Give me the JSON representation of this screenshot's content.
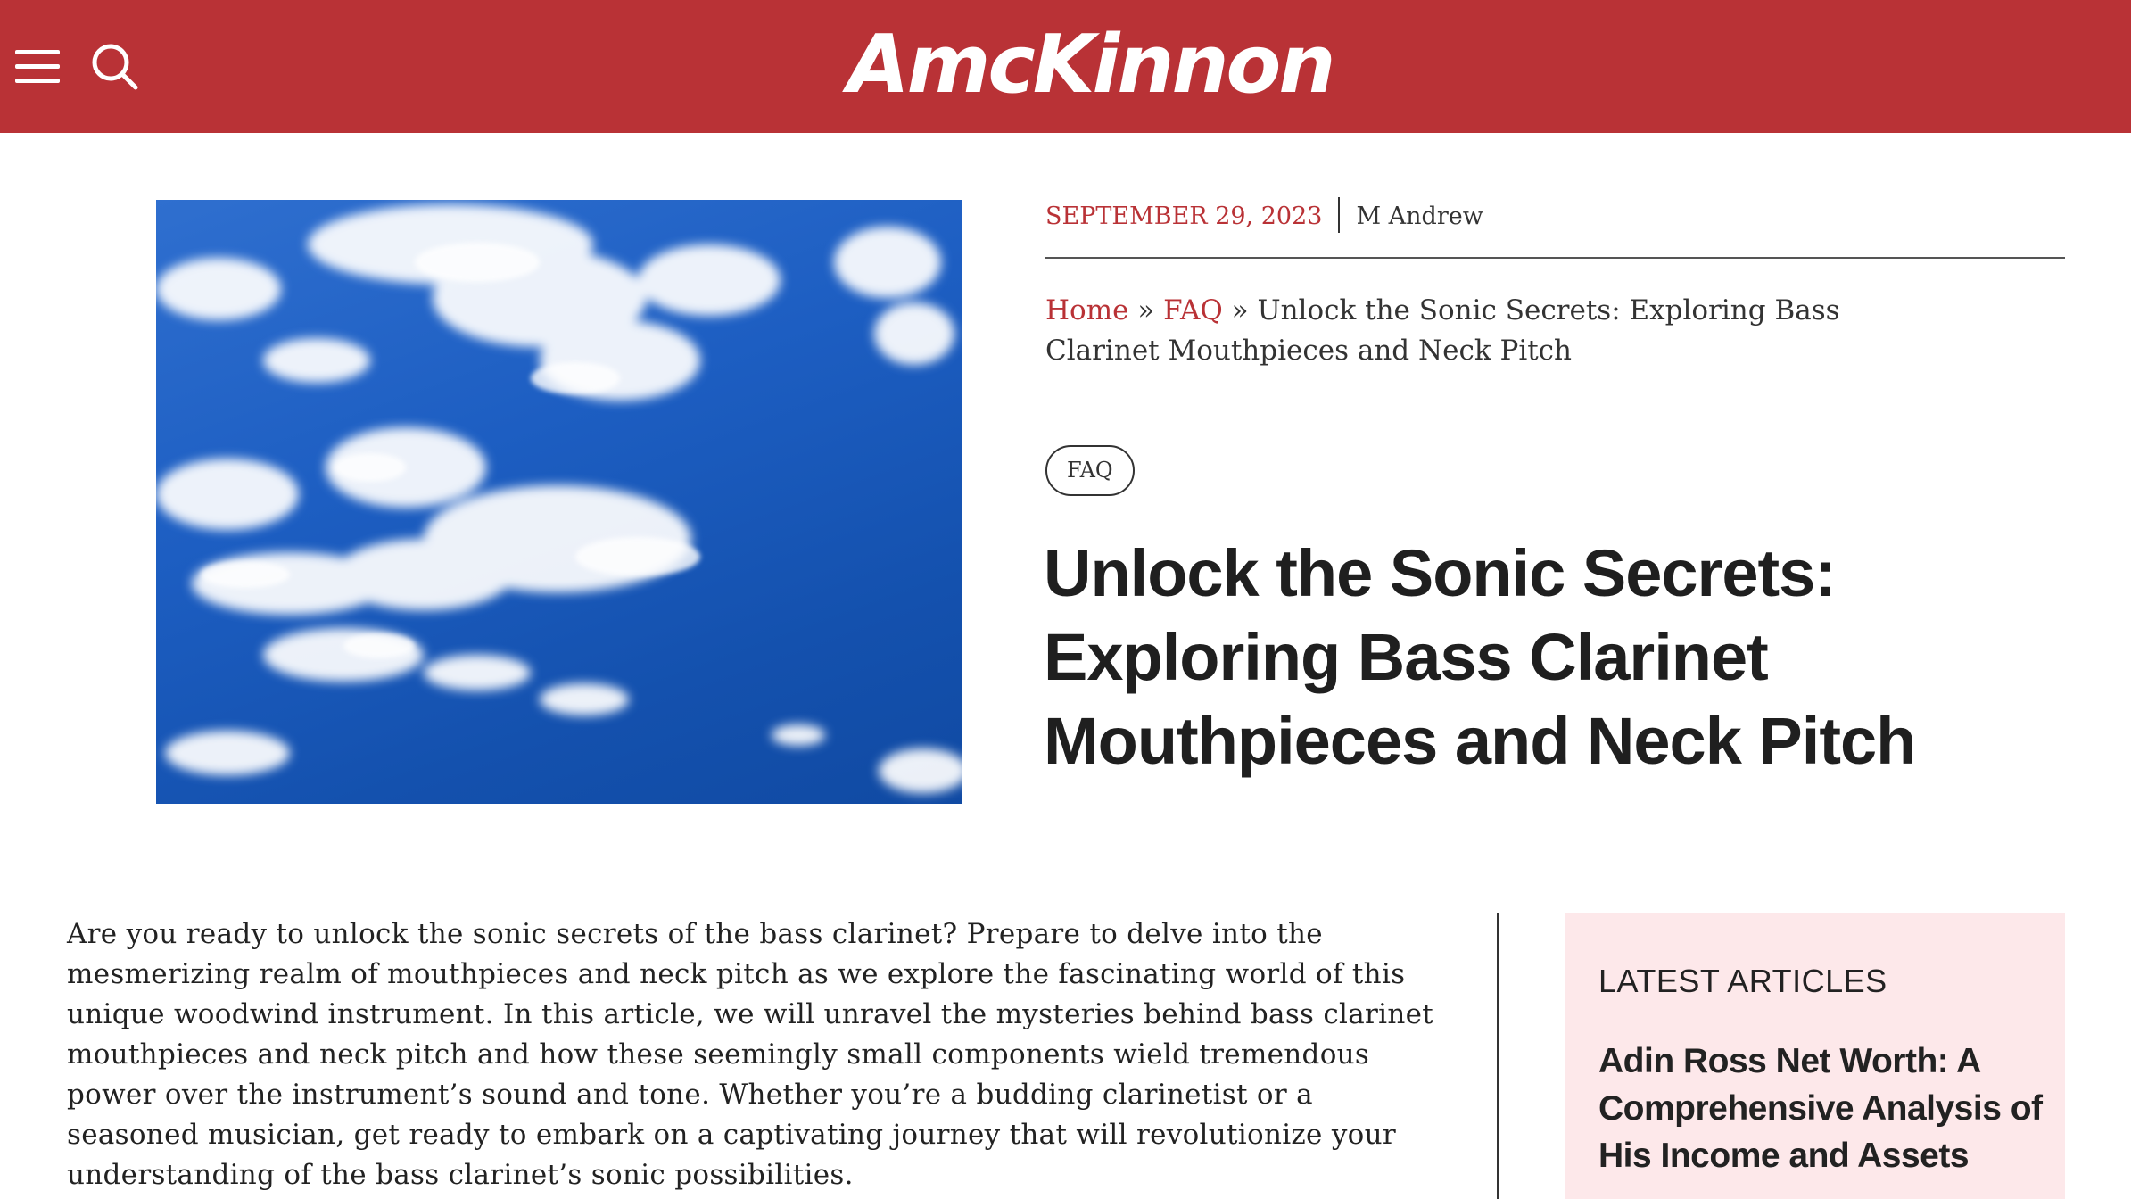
{
  "header": {
    "logo_text": "AmcKinnon",
    "menu_icon": "hamburger-menu-icon",
    "search_icon": "search-icon",
    "background_color": "#b93236"
  },
  "post": {
    "date": "SEPTEMBER 29, 2023",
    "author": "M Andrew",
    "breadcrumb": {
      "home": "Home",
      "separator": "»",
      "category": "FAQ",
      "current": "Unlock the Sonic Secrets: Exploring Bass Clarinet Mouthpieces and Neck Pitch"
    },
    "category_pill": "FAQ",
    "title": "Unlock the Sonic Secrets: Exploring Bass Clarinet Mouthpieces and Neck Pitch",
    "featured_image_alt": "blue sky with white clouds",
    "intro": "Are you ready to unlock the sonic secrets of the bass clarinet? Prepare to delve into the mesmerizing realm of mouthpieces and neck pitch as we explore the fascinating world of this unique woodwind instrument. In this article, we will unravel the mysteries behind bass clarinet mouthpieces and neck pitch and how these seemingly small components wield tremendous power over the instrument’s sound and tone. Whether you’re a budding clarinetist or a seasoned musician, get ready to embark on a captivating journey that will revolutionize your understanding of the bass clarinet’s sonic possibilities."
  },
  "sidebar": {
    "heading": "LATEST ARTICLES",
    "articles": [
      {
        "title": "Adin Ross Net Worth: A Comprehensive Analysis of His Income and Assets"
      }
    ],
    "background_color": "#fde8ea"
  },
  "colors": {
    "accent": "#b93236",
    "text": "#222222"
  }
}
